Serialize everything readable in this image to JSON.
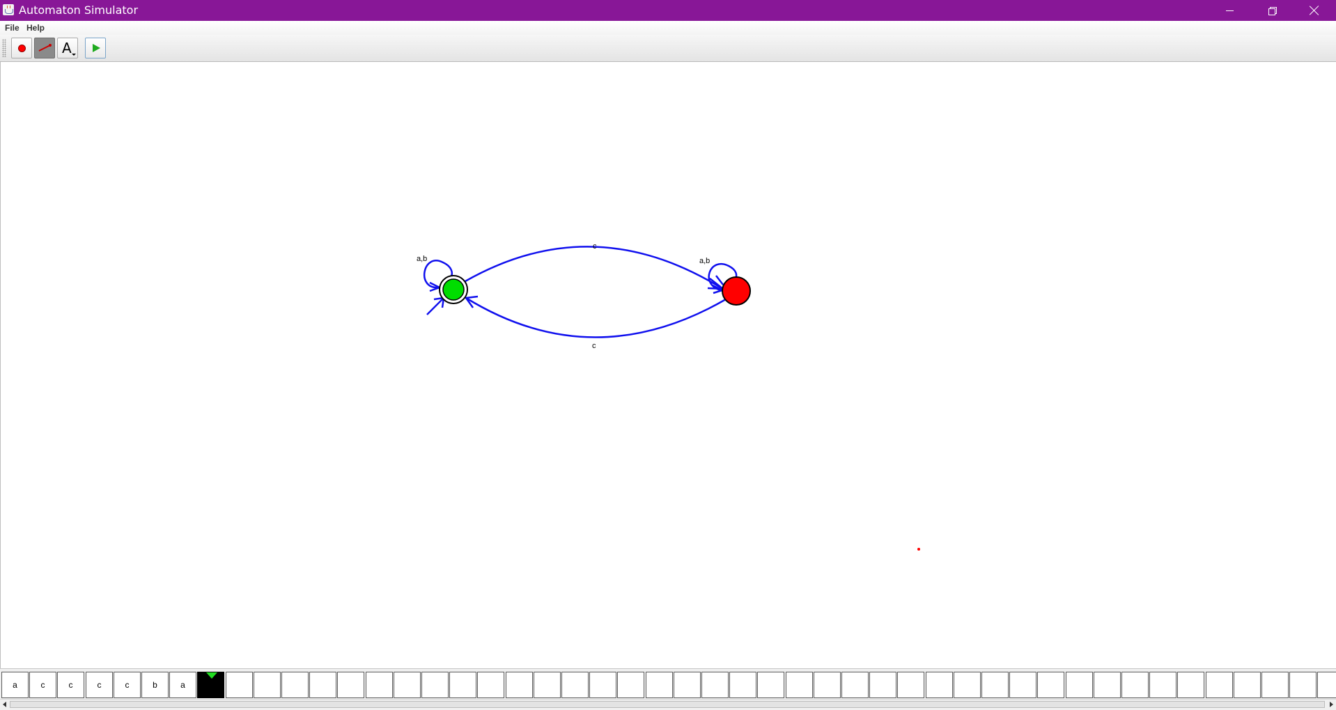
{
  "window": {
    "title": "Automaton Simulator",
    "title_bar_color": "#881797",
    "app_icon": "java-cup-icon",
    "controls": [
      "minimize-icon",
      "restore-icon",
      "close-icon"
    ]
  },
  "menu": {
    "items": [
      {
        "label": "File"
      },
      {
        "label": "Help"
      }
    ]
  },
  "toolbar": {
    "tools": [
      {
        "name": "state-tool",
        "icon": "red-circle-icon"
      },
      {
        "name": "transition-tool",
        "icon": "arrow-line-icon",
        "selected": true
      },
      {
        "name": "text-tool",
        "icon": "text-a-icon",
        "glyph": "A"
      },
      {
        "name": "run-tool",
        "icon": "play-icon"
      }
    ]
  },
  "automaton": {
    "states": [
      {
        "id": "start-accepting-state",
        "fill": "#00dd00",
        "initial": true,
        "accepting": true
      },
      {
        "id": "rejecting-state",
        "fill": "#ff0000",
        "initial": false,
        "accepting": false
      }
    ],
    "transitions": [
      {
        "from": "start-accepting-state",
        "to": "start-accepting-state",
        "label": "a,b"
      },
      {
        "from": "rejecting-state",
        "to": "rejecting-state",
        "label": "a,b"
      },
      {
        "from": "start-accepting-state",
        "to": "rejecting-state",
        "label": "c"
      },
      {
        "from": "rejecting-state",
        "to": "start-accepting-state",
        "label": "c"
      }
    ],
    "edge_color": "#1010ee"
  },
  "tape": {
    "cells": [
      "a",
      "c",
      "c",
      "c",
      "c",
      "b",
      "a",
      "",
      "",
      "",
      "",
      "",
      "",
      "",
      "",
      "",
      "",
      "",
      "",
      "",
      "",
      "",
      "",
      "",
      "",
      "",
      "",
      "",
      "",
      "",
      "",
      "",
      "",
      "",
      "",
      "",
      "",
      "",
      "",
      "",
      "",
      "",
      "",
      "",
      "",
      "",
      "",
      ""
    ],
    "head_index": 7,
    "head_color": "#22dd22"
  }
}
